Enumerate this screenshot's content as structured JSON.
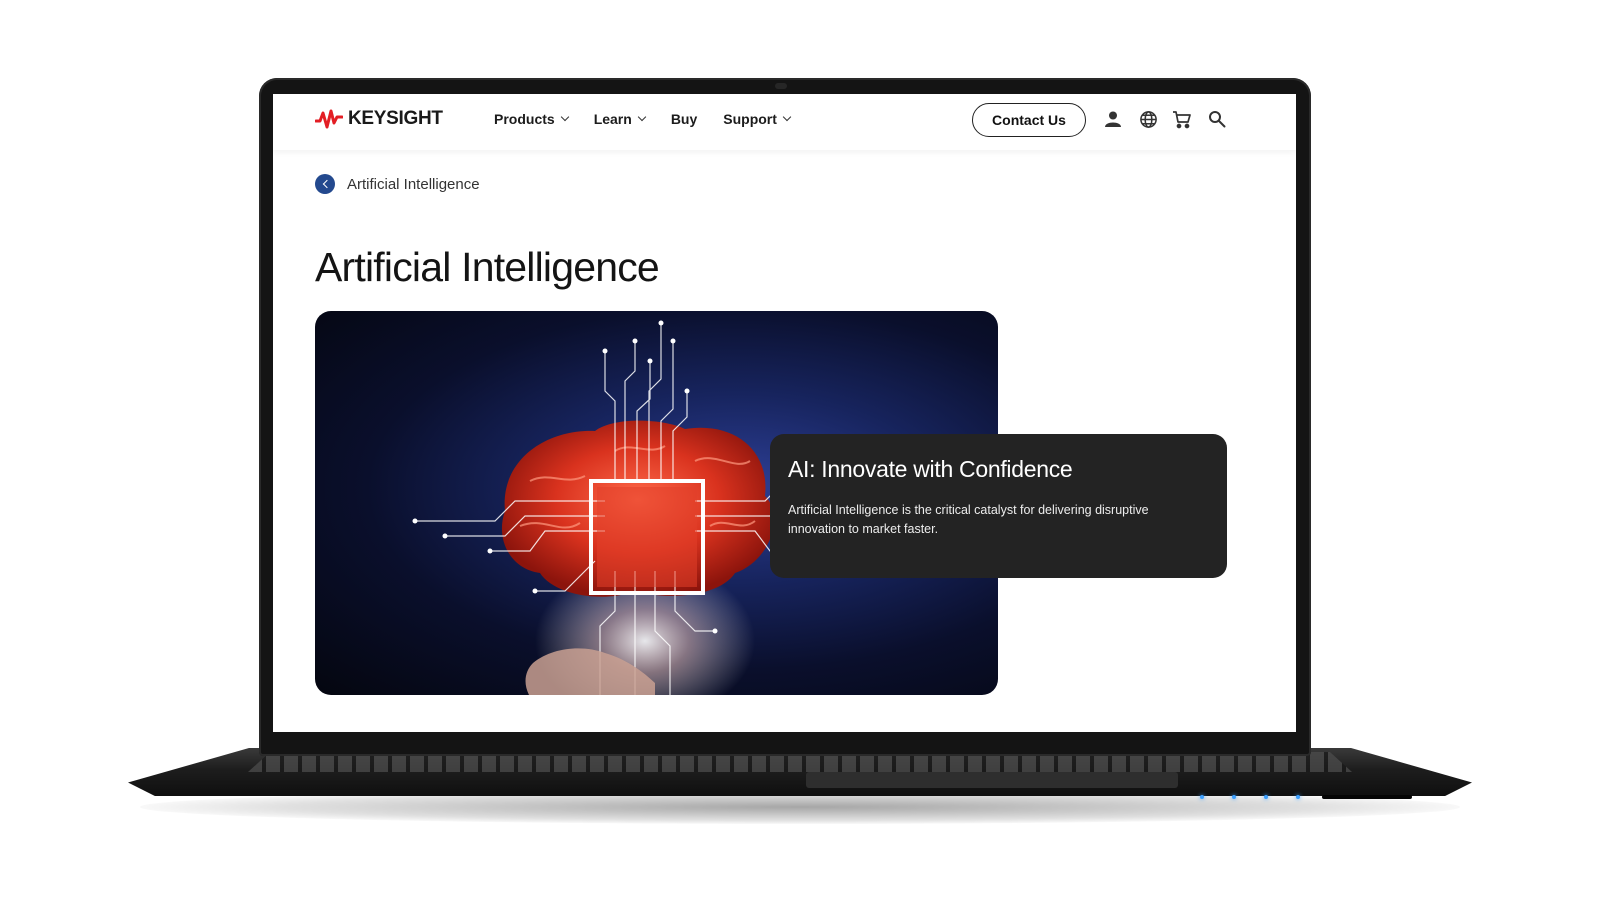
{
  "brand": {
    "name": "KEYSIGHT",
    "accent_color": "#e31e24"
  },
  "nav": {
    "items": [
      {
        "label": "Products",
        "has_dropdown": true
      },
      {
        "label": "Learn",
        "has_dropdown": true
      },
      {
        "label": "Buy",
        "has_dropdown": false
      },
      {
        "label": "Support",
        "has_dropdown": true
      }
    ],
    "contact_label": "Contact Us",
    "icons": [
      "user-icon",
      "globe-icon",
      "cart-icon",
      "search-icon"
    ]
  },
  "breadcrumb": {
    "label": "Artificial Intelligence",
    "back_icon": "chevron-left-icon",
    "color": "#23498e"
  },
  "page": {
    "title": "Artificial Intelligence"
  },
  "hero": {
    "image_subject": "brain-circuit-image"
  },
  "feature_card": {
    "title": "AI: Innovate with Confidence",
    "description": "Artificial Intelligence is the critical catalyst for delivering disruptive innovation to market faster.",
    "background": "#232323"
  }
}
